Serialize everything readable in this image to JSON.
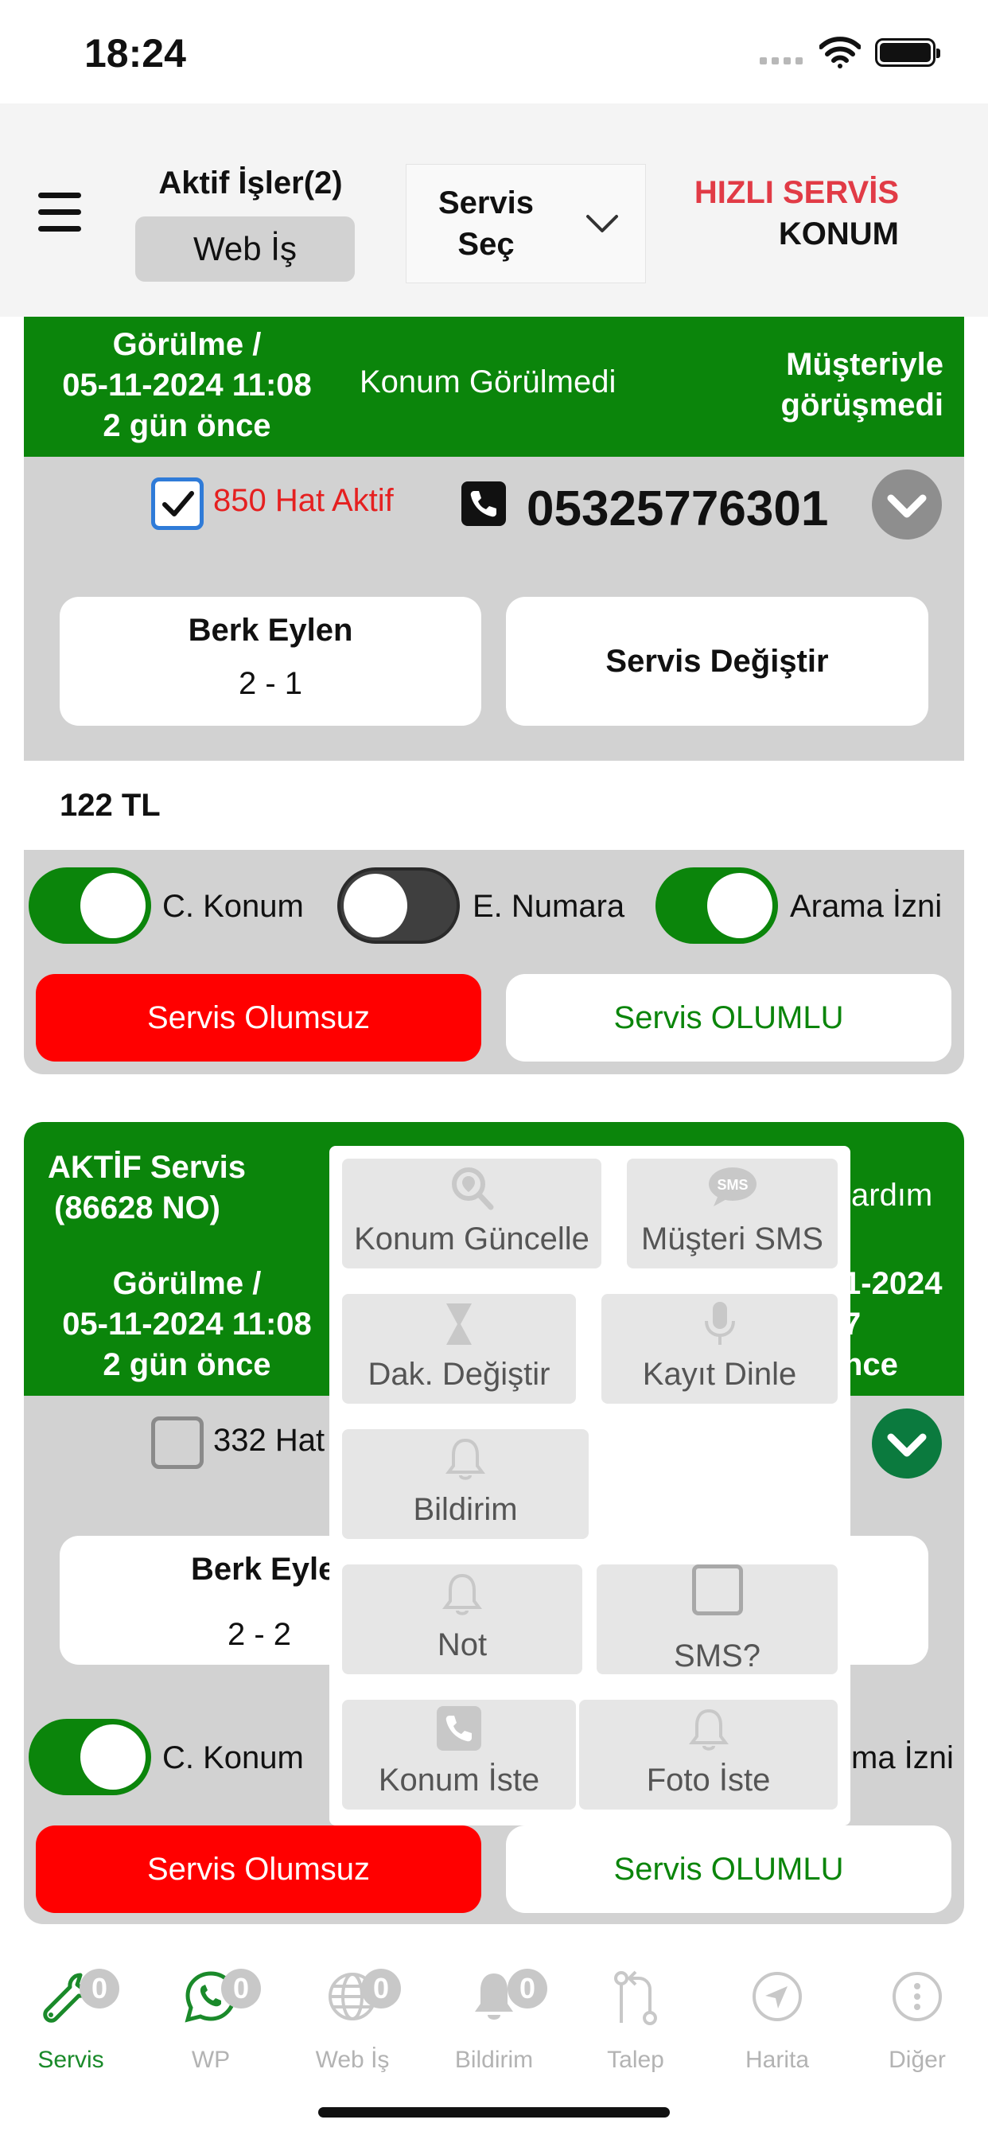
{
  "status_bar": {
    "time": "18:24"
  },
  "header": {
    "active_jobs": "Aktif İşler(2)",
    "web_is": "Web İş",
    "service_select_line1": "Servis",
    "service_select_line2": "Seç",
    "hizli_servis": "HIZLI SERVİS",
    "konum": "KONUM"
  },
  "card1": {
    "seen_line1": "Görülme /",
    "seen_line2": "05-11-2024 11:08",
    "seen_line3": "2 gün önce",
    "location_status": "Konum Görülmedi",
    "contact_line1": "Müşteriyle",
    "contact_line2": "görüşmedi",
    "line_label": "850 Hat Aktif",
    "phone": "05325776301",
    "customer_name": "Berk Eylen",
    "customer_sub": "2 -   1",
    "change_service": "Servis Değiştir",
    "price": "122 TL",
    "toggle1": "C. Konum",
    "toggle2": "E. Numara",
    "toggle3": "Arama İzni",
    "btn_negative": "Servis Olumsuz",
    "btn_positive": "Servis OLUMLU"
  },
  "card2": {
    "title_line1": "AKTİF Servis",
    "title_line2": "(86628 NO)",
    "right_top": "ardım",
    "seen_line1": "Görülme /",
    "seen_line2": "05-11-2024 11:08",
    "seen_line3": "2 gün önce",
    "right_r1": "1-2024",
    "right_r2": "7",
    "right_r3": "nce",
    "line_label": "332 Hat",
    "customer_name": "Berk Eyle",
    "customer_sub": "2 -   2",
    "toggle1": "C. Konum",
    "toggle3": "ma İzni",
    "btn_negative": "Servis Olumsuz",
    "btn_positive": "Servis OLUMLU"
  },
  "popup": {
    "konum_guncelle": "Konum Güncelle",
    "musteri_sms": "Müşteri SMS",
    "sms_icon_text": "SMS",
    "dak_degistir": "Dak. Değiştir",
    "kayit_dinle": "Kayıt Dinle",
    "bildirim": "Bildirim",
    "not": "Not",
    "sms_q": "SMS?",
    "konum_iste": "Konum İste",
    "foto_iste": "Foto İste"
  },
  "bottom_nav": {
    "servis": "Servis",
    "servis_badge": "0",
    "wp": "WP",
    "wp_badge": "0",
    "web_is": "Web İş",
    "web_is_badge": "0",
    "bildirim": "Bildirim",
    "bildirim_badge": "0",
    "talep": "Talep",
    "harita": "Harita",
    "diger": "Diğer"
  },
  "colors": {
    "green": "#0b850b",
    "red": "#ff0000",
    "header_red": "#e13b46",
    "checkbox_blue": "#2f7bd8"
  }
}
